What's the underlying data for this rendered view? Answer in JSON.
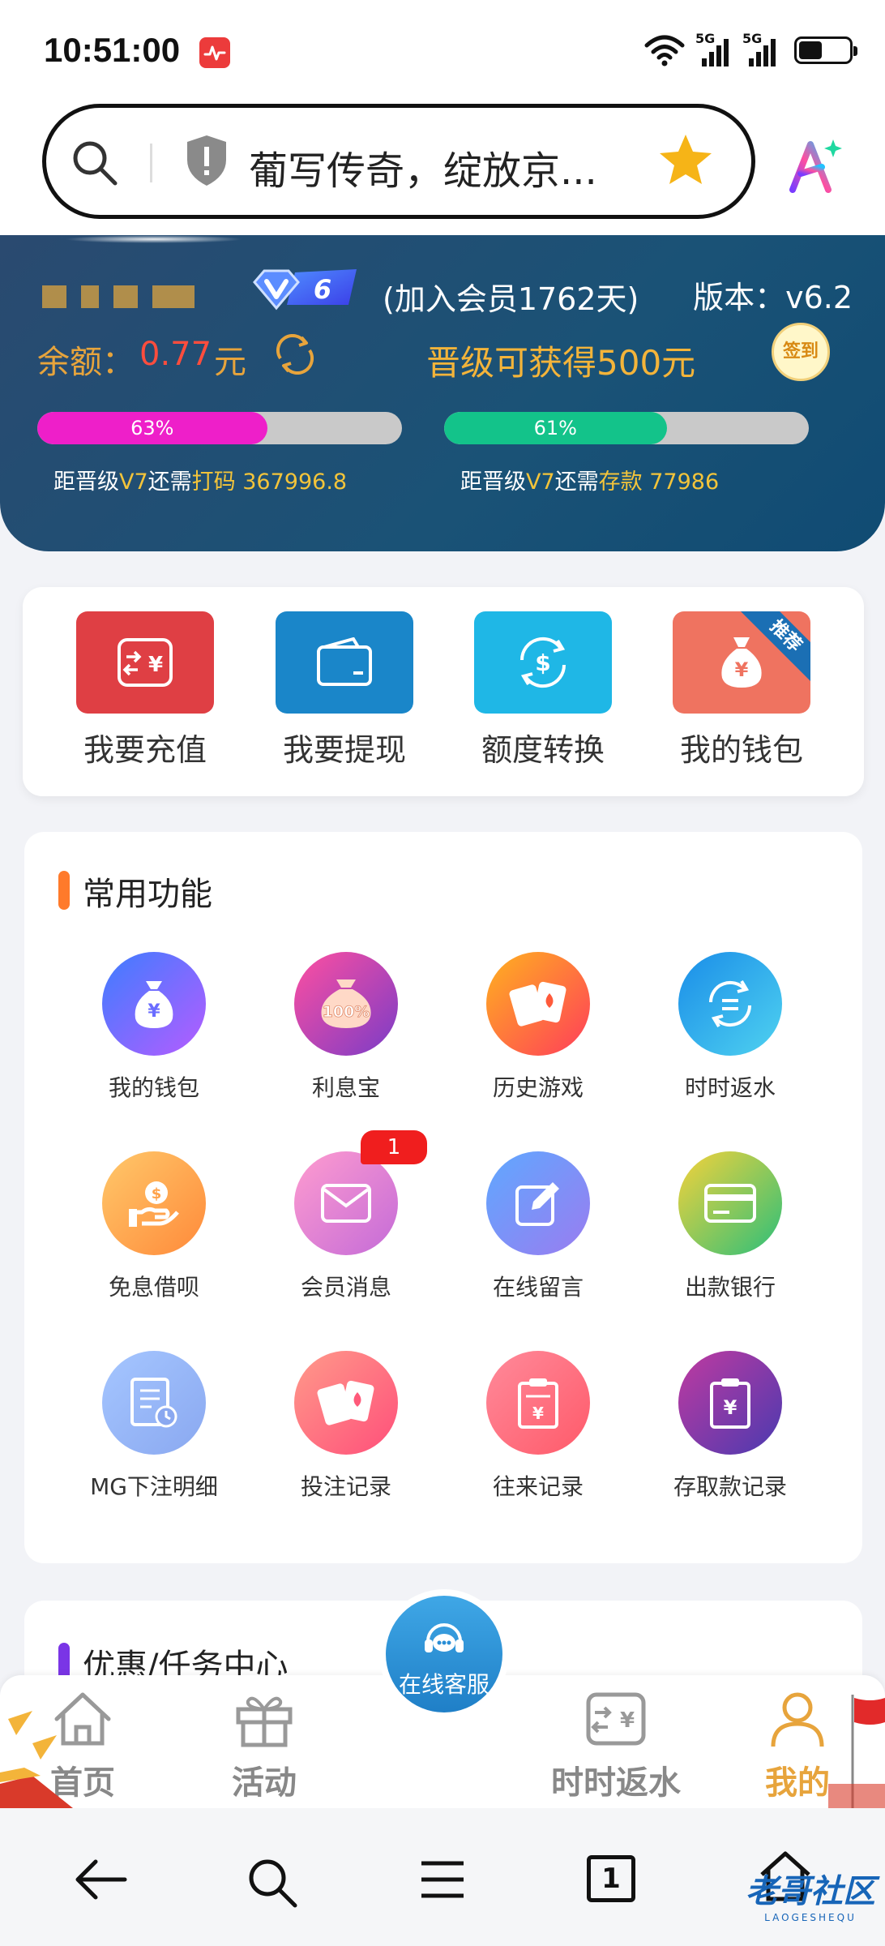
{
  "status": {
    "time": "10:51:00",
    "net1": "5G",
    "net2": "5G"
  },
  "browser": {
    "url_text": "葡写传奇，绽放京..."
  },
  "member": {
    "join_days": "(加入会员1762天)",
    "version": "版本：v6.2",
    "vip_level": "6",
    "balance_label": "余额：",
    "balance_value": "0.77",
    "balance_unit": "元",
    "upgrade_text": "晋级可获得500元",
    "signin_label": "签到",
    "progress": [
      {
        "percent_label": "63%",
        "value": 0.63,
        "color": "#ee1fc9",
        "prefix": "距晋级",
        "level": "V7",
        "mid": "还需",
        "kind": "打码",
        "amount": "367996.8"
      },
      {
        "percent_label": "61%",
        "value": 0.61,
        "color": "#13c38a",
        "prefix": "距晋级",
        "level": "V7",
        "mid": "还需",
        "kind": "存款",
        "amount": "77986"
      }
    ]
  },
  "quick_actions": [
    {
      "label": "我要充值",
      "color": "#df3f44"
    },
    {
      "label": "我要提现",
      "color": "#1a86c9"
    },
    {
      "label": "额度转换",
      "color": "#1fb7e6"
    },
    {
      "label": "我的钱包",
      "color": "#ef7360",
      "ribbon": "推荐"
    }
  ],
  "common": {
    "title": "常用功能",
    "accent": "#ff7a2b",
    "items": [
      {
        "label": "我的钱包",
        "icon": "money-bag-icon"
      },
      {
        "label": "利息宝",
        "icon": "interest-bag-icon"
      },
      {
        "label": "历史游戏",
        "icon": "cards-icon"
      },
      {
        "label": "时时返水",
        "icon": "rebate-icon"
      },
      {
        "label": "免息借呗",
        "icon": "loan-icon"
      },
      {
        "label": "会员消息",
        "icon": "mail-icon",
        "badge": "1"
      },
      {
        "label": "在线留言",
        "icon": "edit-icon"
      },
      {
        "label": "出款银行",
        "icon": "bank-card-icon"
      },
      {
        "label": "MG下注明细",
        "icon": "bet-detail-icon"
      },
      {
        "label": "投注记录",
        "icon": "bet-record-icon"
      },
      {
        "label": "往来记录",
        "icon": "transaction-icon"
      },
      {
        "label": "存取款记录",
        "icon": "deposit-record-icon"
      }
    ]
  },
  "promo": {
    "title": "优惠/任务中心",
    "accent": "#7a35e6"
  },
  "tabs": [
    {
      "label": "首页"
    },
    {
      "label": "活动"
    },
    {
      "label": "在线客服"
    },
    {
      "label": "时时返水"
    },
    {
      "label": "我的"
    }
  ],
  "watermark": {
    "text": "老哥社区",
    "sub": "LAOGESHEQU"
  },
  "sysnav": {
    "tab_count": "1"
  }
}
